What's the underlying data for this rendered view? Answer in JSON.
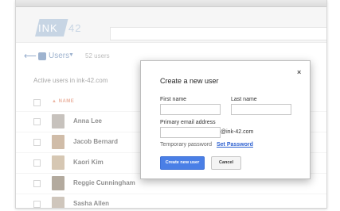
{
  "logo": {
    "ink": "INK",
    "num": "42"
  },
  "toolbar": {
    "users_label": "Users",
    "users_count": "52 users"
  },
  "main": {
    "active_text": "Active users in ink-42.com",
    "sort_column": "NAME",
    "rows": [
      {
        "name": "Anna Lee",
        "avatar_color": "#a9a19a"
      },
      {
        "name": "Jacob Bernard",
        "avatar_color": "#b7987a"
      },
      {
        "name": "Kaori Kim",
        "avatar_color": "#c1a98b"
      },
      {
        "name": "Reggie Cunningham",
        "avatar_color": "#8a7d6b"
      },
      {
        "name": "Sasha Allen",
        "avatar_color": "#b5a899"
      }
    ]
  },
  "dialog": {
    "title": "Create a new user",
    "close": "×",
    "first_name_label": "First name",
    "last_name_label": "Last name",
    "first_name_value": "",
    "last_name_value": "",
    "email_label": "Primary email address",
    "email_value": "",
    "domain": "@ink-42.com",
    "temp_password_label": "Temporary password",
    "set_password_link": "Set Password",
    "create_button": "Create new user",
    "cancel_button": "Cancel"
  },
  "colors": {
    "accent": "#4a7fe6",
    "brand": "#a9bfd6",
    "sort": "#e08a6e"
  }
}
